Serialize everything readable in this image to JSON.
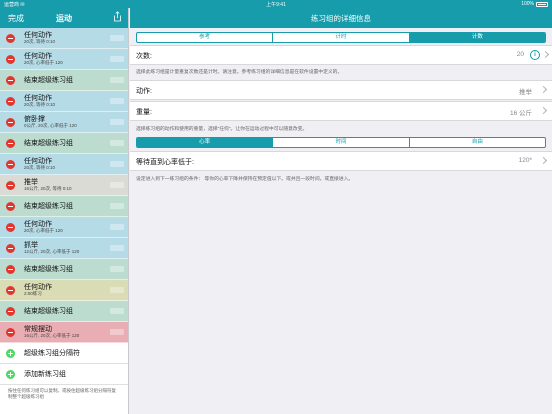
{
  "status_bar": {
    "carrier": "运营商 ✉",
    "time": "上午9:41",
    "battery": "100%"
  },
  "left": {
    "done_label": "完成",
    "title": "运动",
    "items": [
      {
        "name": "任何动作",
        "desc": "20次, 等待 0:10",
        "color": "blue"
      },
      {
        "name": "任何动作",
        "desc": "20次, 心率低于 120",
        "color": "blue"
      },
      {
        "name": "结束超级练习组",
        "desc": "",
        "color": "green"
      },
      {
        "name": "任何动作",
        "desc": "20次, 等待 0:10",
        "color": "blue"
      },
      {
        "name": "俯卧撑",
        "desc": "0公斤, 20次, 心率低于 120",
        "color": "blue"
      },
      {
        "name": "结束超级练习组",
        "desc": "",
        "color": "green"
      },
      {
        "name": "任何动作",
        "desc": "20次, 等待 0:10",
        "color": "blue"
      },
      {
        "name": "推举",
        "desc": "16公斤, 20次, 等待 0:10",
        "color": "gray"
      },
      {
        "name": "结束超级练习组",
        "desc": "",
        "color": "green"
      },
      {
        "name": "任何动作",
        "desc": "20次, 心率低于 120",
        "color": "blue"
      },
      {
        "name": "抓举",
        "desc": "12公斤, 20次, 心率低于 120",
        "color": "blue"
      },
      {
        "name": "结束超级练习组",
        "desc": "",
        "color": "green"
      },
      {
        "name": "任何动作",
        "desc": "2:00练习",
        "color": "yellow"
      },
      {
        "name": "结束超级练习组",
        "desc": "",
        "color": "green"
      },
      {
        "name": "常规摆动",
        "desc": "16公斤, 20次, 心率低于 120",
        "color": "red"
      }
    ],
    "add_superset_divider": "超级练习组分隔符",
    "add_new_set": "添加新练习组",
    "footer_note": "按住任何练习组可以复制。或按住超级练习组分隔符复制整个超级练习组"
  },
  "right": {
    "title": "练习组的详细信息",
    "tabs1": [
      {
        "label": "参考",
        "active": false
      },
      {
        "label": "计时",
        "active": false
      },
      {
        "label": "计数",
        "active": true
      }
    ],
    "counts": {
      "label": "次数:",
      "value": "20",
      "info": "i"
    },
    "counts_note": "选择此练习组是计量重复次数还是计时。请注意。参考练习组的详细信息是在软件设置中定义的。",
    "action": {
      "label": "动作:",
      "value": "推举"
    },
    "weight": {
      "label": "重量:",
      "value": "16 公斤"
    },
    "weight_note": "选择练习组的动作和使用的重量，选择\"任何\"。让你在运动过程中可以随意改变。",
    "tabs2": [
      {
        "label": "心率",
        "active": true
      },
      {
        "label": "时间",
        "active": false
      },
      {
        "label": "自由",
        "active": false
      }
    ],
    "heart": {
      "label": "等待直到心率低于:",
      "value": "120*"
    },
    "heart_note": "设定进入到下一练习组的条件： 等你的心率下降并保持在预定值以下。或并且一段时间，或直接进入。"
  },
  "colors": {
    "accent": "#169cab",
    "delete": "#e3362f",
    "add": "#4cd964"
  }
}
